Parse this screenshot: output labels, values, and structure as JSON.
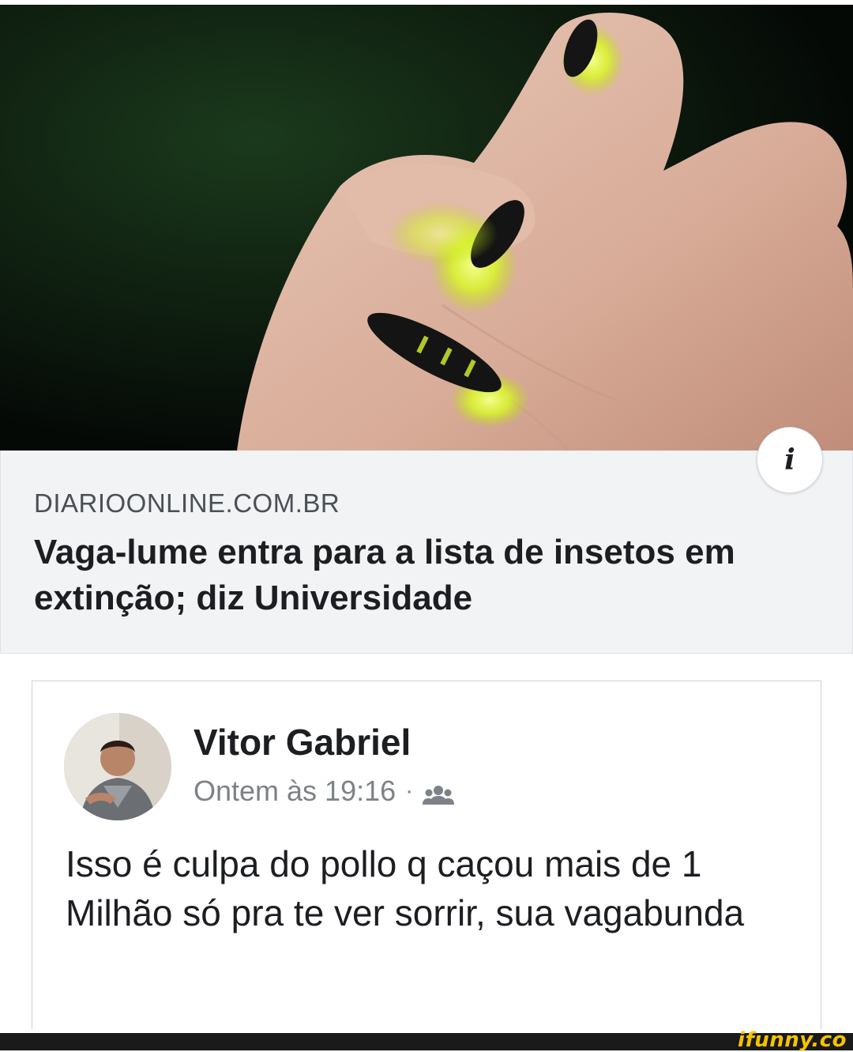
{
  "link_preview": {
    "domain": "DIARIOONLINE.COM.BR",
    "headline": "Vaga-lume entra para a lista de insetos em extinção; diz Universidade",
    "info_icon": "i"
  },
  "post": {
    "author": "Vitor Gabriel",
    "timestamp": "Ontem às 19:16",
    "separator": "·",
    "audience_icon": "friends-icon",
    "text": "Isso é culpa do pollo q caçou mais de 1 Milhão só pra te ver sorrir, sua vagabunda"
  },
  "watermark": {
    "text": "ifunny.co",
    "color": "#f5c400"
  },
  "colors": {
    "caption_bg": "#f2f3f5",
    "text_primary": "#1c1e21",
    "text_secondary": "#7d8188",
    "firefly_glow": "#e6ff3a"
  }
}
